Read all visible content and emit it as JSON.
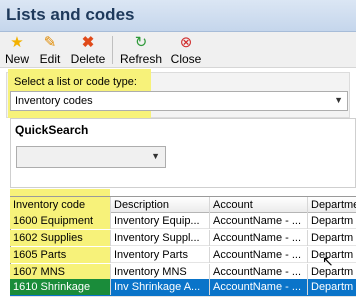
{
  "window": {
    "title": "Lists and codes"
  },
  "toolbar": {
    "new": {
      "label": "New",
      "icon": "star-icon",
      "color": "#f2b100"
    },
    "edit": {
      "label": "Edit",
      "icon": "pencil-icon",
      "color": "#e08a00"
    },
    "delete": {
      "label": "Delete",
      "icon": "x-icon",
      "color": "#e04a1a"
    },
    "refresh": {
      "label": "Refresh",
      "icon": "refresh-icon",
      "color": "#2f9a3a"
    },
    "close": {
      "label": "Close",
      "icon": "close-icon",
      "color": "#d02a2a"
    }
  },
  "selector": {
    "label": "Select a list or code type:",
    "value": "Inventory codes"
  },
  "quicksearch": {
    "label": "QuickSearch",
    "value": ""
  },
  "grid": {
    "columns": [
      "Inventory code",
      "Description",
      "Account",
      "Departme"
    ],
    "rows": [
      [
        "1600 Equipment",
        "Inventory Equip...",
        "AccountName - ...",
        "Departm"
      ],
      [
        "1602 Supplies",
        "Inventory Suppl...",
        "AccountName - ...",
        "Departm"
      ],
      [
        "1605 Parts",
        "Inventory Parts",
        "AccountName - ...",
        "Departm"
      ],
      [
        "1607 MNS",
        "Inventory MNS",
        "AccountName - ...",
        "Departm"
      ],
      [
        "1610 Shrinkage",
        "Inv Shrinkage A...",
        "AccountName - ...",
        "Departm"
      ]
    ],
    "selected_row": 4
  },
  "highlight_color": "#f7f27a",
  "selection_color": "#0a74c9"
}
